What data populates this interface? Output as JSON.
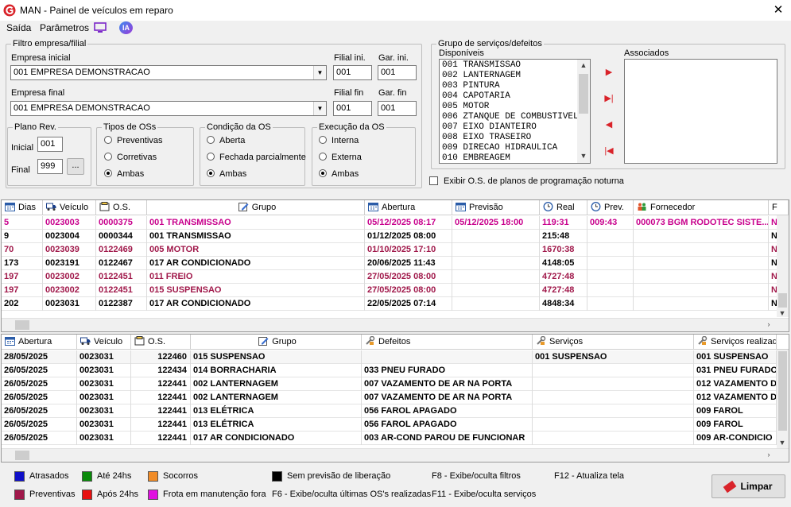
{
  "window": {
    "title": "MAN - Painel de veículos em reparo",
    "close": "✕"
  },
  "menu": {
    "items": [
      "Saída",
      "Parâmetros"
    ],
    "ia": "IA"
  },
  "filtro": {
    "legend": "Filtro empresa/filial",
    "empresa_inicial_label": "Empresa inicial",
    "empresa_inicial": "001 EMPRESA DEMONSTRACAO",
    "filial_ini_label": "Filial ini.",
    "filial_ini": "001",
    "gar_ini_label": "Gar. ini.",
    "gar_ini": "001",
    "empresa_final_label": "Empresa final",
    "empresa_final": "001 EMPRESA DEMONSTRACAO",
    "filial_fin_label": "Filial fin",
    "filial_fin": "001",
    "gar_fin_label": "Gar. fin",
    "gar_fin": "001"
  },
  "plano": {
    "legend": "Plano Rev.",
    "inicial_label": "Inicial",
    "inicial": "001",
    "final_label": "Final",
    "final": "999",
    "browse": "..."
  },
  "tipos": {
    "legend": "Tipos de OSs",
    "options": [
      "Preventivas",
      "Corretivas",
      "Ambas"
    ],
    "selected": "Ambas"
  },
  "condicao": {
    "legend": "Condição da OS",
    "options": [
      "Aberta",
      "Fechada parcialmente",
      "Ambas"
    ],
    "selected": "Ambas"
  },
  "execucao": {
    "legend": "Execução da OS",
    "options": [
      "Interna",
      "Externa",
      "Ambas"
    ],
    "selected": "Ambas"
  },
  "grupo": {
    "legend": "Grupo de serviços/defeitos",
    "disponiveis_label": "Disponíveis",
    "associados_label": "Associados",
    "disponiveis": [
      "001 TRANSMISSAO",
      "002 LANTERNAGEM",
      "003 PINTURA",
      "004 CAPOTARIA",
      "005 MOTOR",
      "006 ZTANQUE DE COMBUSTIVEL",
      "007 EIXO DIANTEIRO",
      "008 EIXO TRASEIRO",
      "009 DIRECAO HIDRAULICA",
      "010 EMBREAGEM"
    ],
    "associados": []
  },
  "noturna": {
    "label": "Exibir O.S. de planos de programação noturna",
    "checked": false
  },
  "grid1": {
    "columns": [
      "Dias",
      "Veículo",
      "O.S.",
      "Grupo",
      "Abertura",
      "Previsão",
      "Real",
      "Prev.",
      "Fornecedor",
      "F"
    ],
    "rows": [
      {
        "color": "pink",
        "cells": [
          "5",
          "0023003",
          "0000375",
          "001  TRANSMISSAO",
          "05/12/2025 08:17",
          "05/12/2025 18:00",
          "119:31",
          "009:43",
          "000073  BGM RODOTEC SISTE...",
          "N"
        ]
      },
      {
        "color": "blk",
        "cells": [
          "9",
          "0023004",
          "0000344",
          "001  TRANSMISSAO",
          "01/12/2025 08:00",
          "",
          "215:48",
          "",
          "",
          "N"
        ]
      },
      {
        "color": "dk",
        "cells": [
          "70",
          "0023039",
          "0122469",
          "005  MOTOR",
          "01/10/2025 17:10",
          "",
          "1670:38",
          "",
          "",
          "N"
        ]
      },
      {
        "color": "blk",
        "cells": [
          "173",
          "0023191",
          "0122467",
          "017   AR CONDICIONADO",
          "20/06/2025 11:43",
          "",
          "4148:05",
          "",
          "",
          "N"
        ]
      },
      {
        "color": "dk",
        "cells": [
          "197",
          "0023002",
          "0122451",
          "011  FREIO",
          "27/05/2025 08:00",
          "",
          "4727:48",
          "",
          "",
          "N"
        ]
      },
      {
        "color": "dk",
        "cells": [
          "197",
          "0023002",
          "0122451",
          "015  SUSPENSAO",
          "27/05/2025 08:00",
          "",
          "4727:48",
          "",
          "",
          "N"
        ]
      },
      {
        "color": "blk",
        "cells": [
          "202",
          "0023031",
          "0122387",
          "017   AR CONDICIONADO",
          "22/05/2025 07:14",
          "",
          "4848:34",
          "",
          "",
          "N"
        ]
      }
    ]
  },
  "grid2": {
    "columns": [
      "Abertura",
      "Veículo",
      "O.S.",
      "Grupo",
      "Defeitos",
      "Serviços",
      "Serviços realizad"
    ],
    "rows": [
      [
        "28/05/2025",
        "0023031",
        "122460",
        "015  SUSPENSAO",
        "",
        "001  SUSPENSAO",
        "001  SUSPENSAO"
      ],
      [
        "26/05/2025",
        "0023031",
        "122434",
        "014  BORRACHARIA",
        "033  PNEU FURADO",
        "",
        "031  PNEU FURADO"
      ],
      [
        "26/05/2025",
        "0023031",
        "122441",
        "002  LANTERNAGEM",
        "007  VAZAMENTO DE AR NA PORTA",
        "",
        "012  VAZAMENTO D"
      ],
      [
        "26/05/2025",
        "0023031",
        "122441",
        "002  LANTERNAGEM",
        "007  VAZAMENTO DE AR NA PORTA",
        "",
        "012  VAZAMENTO D"
      ],
      [
        "26/05/2025",
        "0023031",
        "122441",
        "013  ELÉTRICA",
        "056  FAROL APAGADO",
        "",
        "009  FAROL"
      ],
      [
        "26/05/2025",
        "0023031",
        "122441",
        "013  ELÉTRICA",
        "056  FAROL APAGADO",
        "",
        "009  FAROL"
      ],
      [
        "26/05/2025",
        "0023031",
        "122441",
        "017   AR CONDICIONADO",
        "003  AR-COND PAROU DE FUNCIONAR",
        "",
        "009  AR-CONDICIO"
      ]
    ]
  },
  "legend": {
    "items": [
      {
        "label": "Atrasados",
        "color": "#1010c8"
      },
      {
        "label": "Até 24hs",
        "color": "#0a8a0a"
      },
      {
        "label": "Socorros",
        "color": "#f08c28"
      },
      {
        "label": "Sem previsão de liberação",
        "color": "#000000"
      },
      {
        "label": "Preventivas",
        "color": "#a0184a"
      },
      {
        "label": "Após 24hs",
        "color": "#e81010"
      },
      {
        "label": "Frota em manutenção fora",
        "color": "#e010e0"
      }
    ],
    "shortcuts": [
      "F8 - Exibe/oculta filtros",
      "F12 - Atualiza tela",
      "F6 - Exibe/oculta últimas OS's realizadas",
      "F11 - Exibe/oculta serviços"
    ]
  },
  "limpar": "Limpar"
}
